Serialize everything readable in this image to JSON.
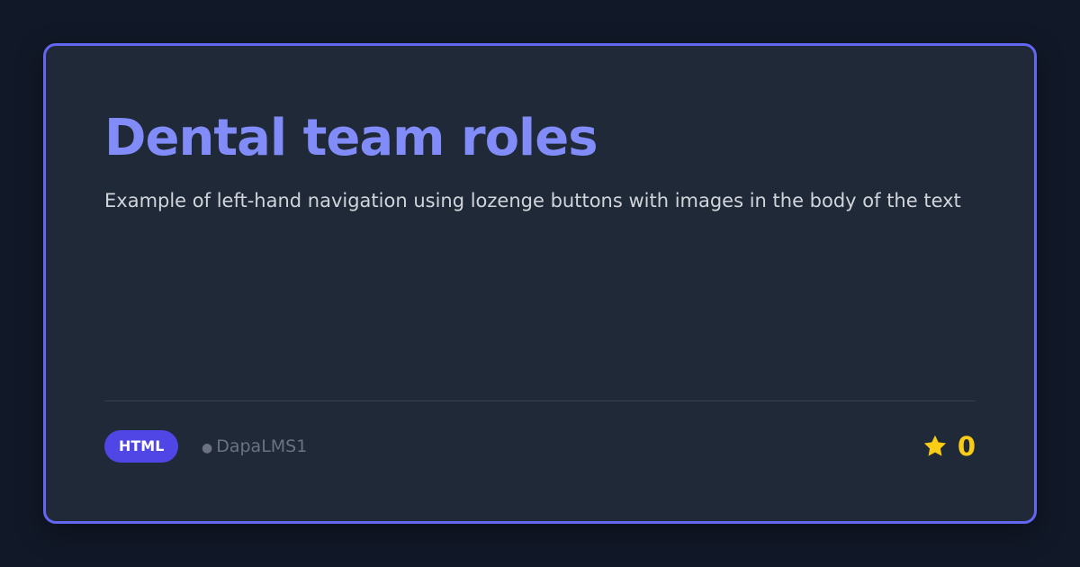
{
  "repo": {
    "title": "Dental team roles",
    "description": "Example of left-hand navigation using lozenge buttons with images in the body of the text",
    "language": "HTML",
    "owner_dot": "●",
    "owner": "DapaLMS1",
    "star_icon": "star-icon",
    "star_count": "0"
  },
  "colors": {
    "background": "#111827",
    "card": "#1f2937",
    "border": "#6366f1",
    "title": "#818cf8",
    "badge": "#4f46e5",
    "star": "#facc15"
  }
}
